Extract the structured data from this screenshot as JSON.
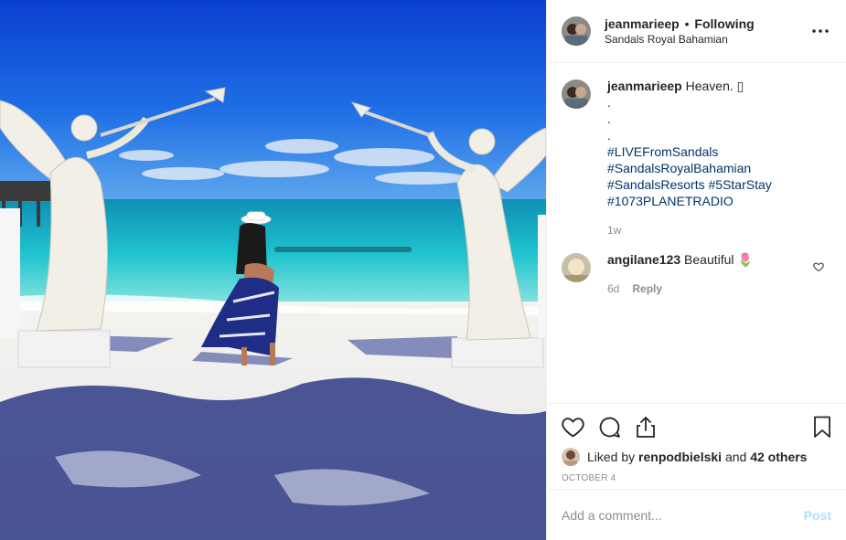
{
  "header": {
    "username": "jeanmarieep",
    "separator": "•",
    "follow_status": "Following",
    "location": "Sandals Royal Bahamian",
    "more_icon": "more-horizontal-icon"
  },
  "caption": {
    "username": "jeanmarieep",
    "text": "Heaven. ▯",
    "dots": ".\n.\n.",
    "hashtags": [
      "#LIVEFromSandals",
      "#SandalsRoyalBahamian",
      "#SandalsResorts #5StarStay",
      "#1073PLANETRADIO"
    ],
    "time": "1w"
  },
  "comments": [
    {
      "username": "angilane123",
      "text": "Beautiful 🌷",
      "time": "6d",
      "reply_label": "Reply"
    }
  ],
  "actions": {
    "like_icon": "heart-icon",
    "comment_icon": "comment-icon",
    "share_icon": "share-icon",
    "save_icon": "bookmark-icon"
  },
  "likes": {
    "prefix": "Liked by",
    "user": "renpodbielski",
    "conjunction": "and",
    "others": "42 others"
  },
  "date": "OCTOBER 4",
  "add_comment": {
    "placeholder": "Add a comment...",
    "post_label": "Post"
  },
  "colors": {
    "link": "#003569",
    "secondary": "#8e8e8e",
    "post_disabled": "#b2dffc",
    "border": "#efefef"
  }
}
